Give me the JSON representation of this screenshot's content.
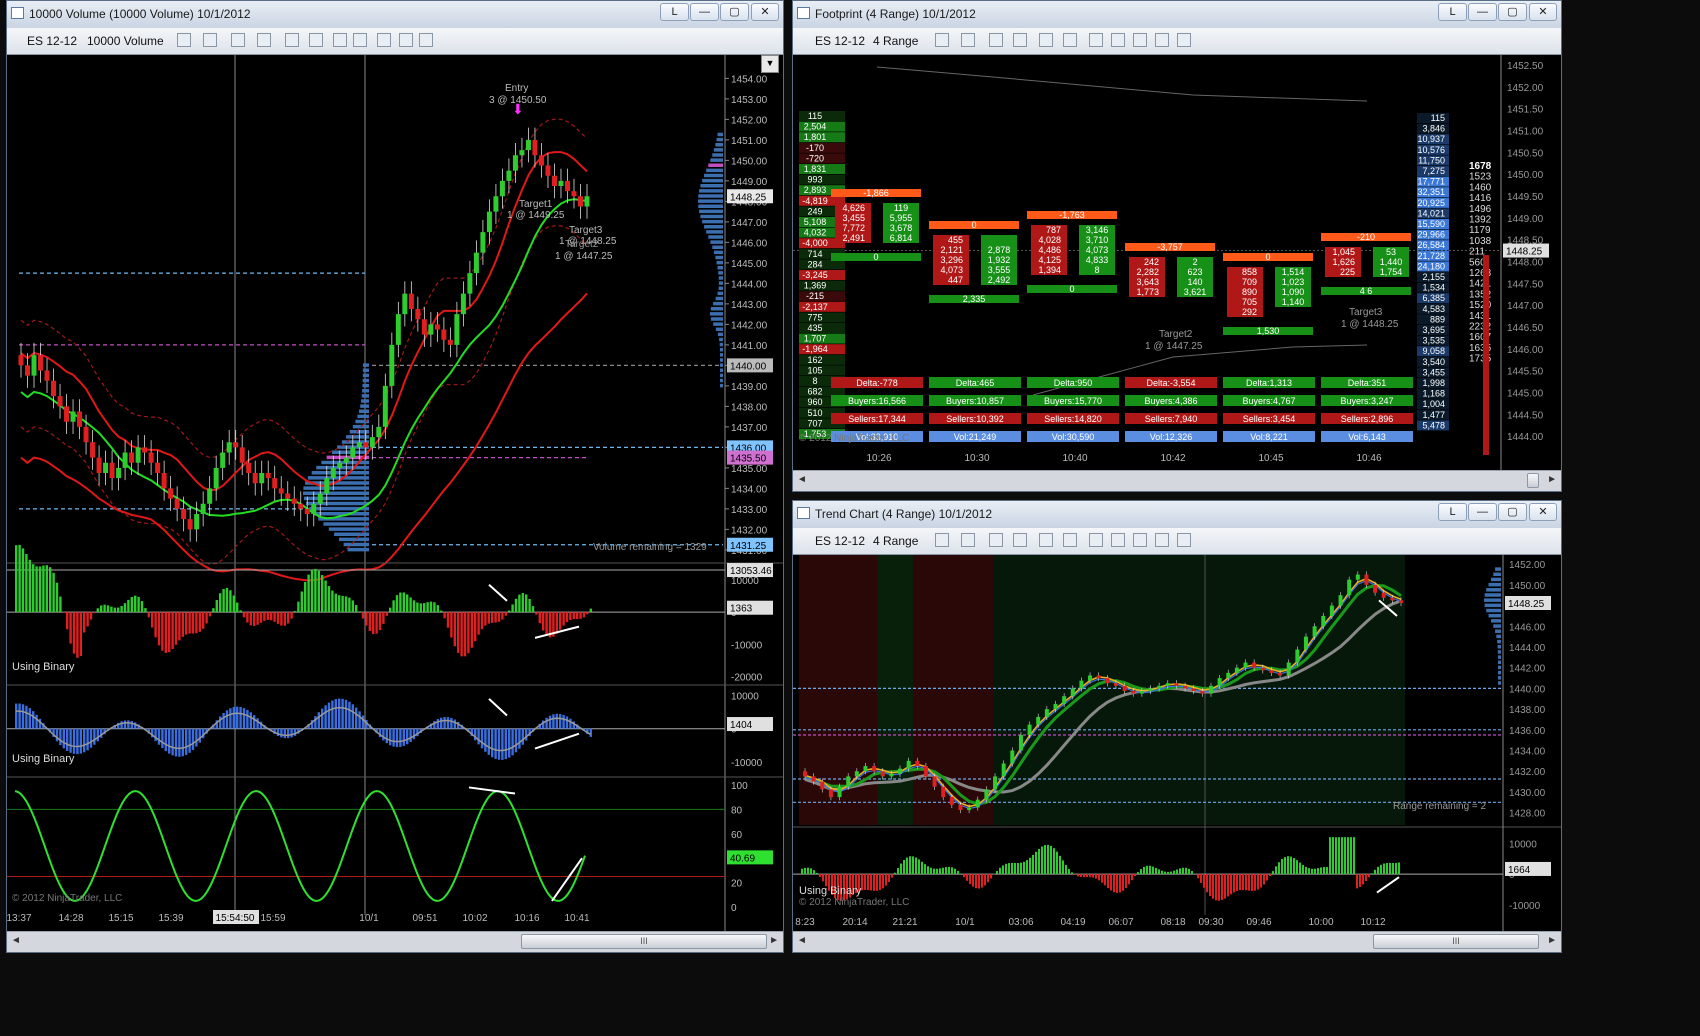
{
  "windows": {
    "left": {
      "title": "10000 Volume (10000 Volume)  10/1/2012",
      "instrument": "ES 12-12",
      "period": "10000 Volume"
    },
    "footprint": {
      "title": "Footprint (4 Range)  10/1/2012",
      "instrument": "ES 12-12",
      "period": "4 Range"
    },
    "trend": {
      "title": "Trend Chart (4 Range)  10/1/2012",
      "instrument": "ES 12-12",
      "period": "4 Range"
    },
    "controls": {
      "link": "L",
      "minimize": "—",
      "maximize": "▢",
      "close": "✕",
      "grip": "III"
    }
  },
  "colors": {
    "bull": "#2ecc2e",
    "bear": "#e02020",
    "blue": "#3a78d8",
    "orange": "#ff5a1a",
    "cyan": "#6fb8f0",
    "magenta": "#c050c0"
  },
  "chart_data": [
    {
      "id": "left-price",
      "type": "candlestick",
      "ylim": [
        1430.75,
        1454.75
      ],
      "y_ticks": [
        "1454.00",
        "1453.00",
        "1452.00",
        "1451.00",
        "1450.00",
        "1449.00",
        "1448.00",
        "1447.00",
        "1446.00",
        "1445.00",
        "1444.00",
        "1443.00",
        "1442.00",
        "1441.00",
        "1440.00",
        "1439.00",
        "1438.00",
        "1437.00",
        "1436.00",
        "1435.00",
        "1434.00",
        "1433.00",
        "1432.00",
        "1431.00"
      ],
      "price_tags": [
        {
          "text": "1448.25",
          "value": 1448.25,
          "color": "#e8e8e8"
        },
        {
          "text": "1440.00",
          "value": 1440.0,
          "color": "#bbbbbb"
        },
        {
          "text": "1436.00",
          "value": 1436.0,
          "color": "#7fc4ff"
        },
        {
          "text": "1435.50",
          "value": 1435.5,
          "color": "#d070d0"
        },
        {
          "text": "1431.25",
          "value": 1431.25,
          "color": "#7fc4ff"
        }
      ],
      "x_ticks": [
        "13:37",
        "14:28",
        "15:15",
        "15:39",
        "15:54:50",
        "15:59",
        "10/1",
        "09:51",
        "10:02",
        "10:16",
        "10:41"
      ],
      "annotations": [
        {
          "text": "Entry",
          "sub": "3 @ 1450.50"
        },
        {
          "text": "Target1",
          "sub": "1 @ 1449.25"
        },
        {
          "text": "Target3",
          "sub": "1 @ 1448.25"
        },
        {
          "text": "Target2",
          "sub": "1 @ 1447.25"
        }
      ],
      "volume_remaining": "Volume remaining = 1329",
      "close_series": [
        1440.0,
        1439.5,
        1440.5,
        1439.75,
        1439.25,
        1438.5,
        1438.0,
        1437.25,
        1437.75,
        1437.0,
        1436.25,
        1435.5,
        1434.75,
        1435.25,
        1434.5,
        1435.0,
        1435.75,
        1435.25,
        1436.0,
        1435.75,
        1435.25,
        1434.75,
        1434.0,
        1433.5,
        1433.0,
        1432.5,
        1432.0,
        1432.75,
        1433.25,
        1434.0,
        1435.0,
        1435.75,
        1436.25,
        1436.0,
        1435.25,
        1434.75,
        1434.25,
        1434.75,
        1434.5,
        1434.0,
        1433.75,
        1433.5,
        1433.25,
        1433.0,
        1432.75,
        1433.25,
        1433.75,
        1434.5,
        1435.0,
        1435.25,
        1435.5,
        1436.0,
        1436.25,
        1436.0,
        1436.5,
        1437.0,
        1439.0,
        1441.0,
        1442.5,
        1443.5,
        1442.75,
        1442.25,
        1441.5,
        1442.0,
        1441.75,
        1441.25,
        1441.0,
        1442.5,
        1443.5,
        1444.5,
        1445.5,
        1446.5,
        1447.5,
        1448.25,
        1449.0,
        1449.5,
        1450.25,
        1450.5,
        1451.0,
        1450.25,
        1449.75,
        1449.25,
        1448.75,
        1449.0,
        1448.5,
        1448.25,
        1447.75,
        1448.25
      ]
    },
    {
      "id": "left-osc1",
      "type": "bar",
      "label": "Using Binary",
      "ylim": [
        -22000,
        14000
      ],
      "y_ticks": [
        "10000",
        "0",
        "-10000",
        "-20000"
      ],
      "tags": [
        {
          "text": "13053.46",
          "value": 13053.46
        },
        {
          "text": "1363",
          "value": 1363
        }
      ]
    },
    {
      "id": "left-osc2",
      "type": "bar",
      "label": "Using Binary",
      "ylim": [
        -14000,
        12000
      ],
      "y_ticks": [
        "10000",
        "0",
        "-10000"
      ],
      "tags": [
        {
          "text": "1404",
          "value": 1404
        }
      ]
    },
    {
      "id": "left-osc3",
      "type": "line",
      "ylim": [
        0,
        100
      ],
      "y_ticks": [
        "100",
        "80",
        "60",
        "40",
        "20",
        "0"
      ],
      "tags": [
        {
          "text": "40.69",
          "value": 40.69
        }
      ],
      "watermark": "© 2012 NinjaTrader, LLC"
    },
    {
      "id": "footprint",
      "type": "footprint",
      "ylim": [
        1443.75,
        1452.5
      ],
      "y_ticks": [
        "1452.50",
        "1452.00",
        "1451.50",
        "1451.00",
        "1450.50",
        "1450.00",
        "1449.50",
        "1449.00",
        "1448.50",
        "1448.00",
        "1447.50",
        "1447.00",
        "1446.50",
        "1446.00",
        "1445.50",
        "1445.00",
        "1444.50",
        "1444.00"
      ],
      "last_price": "1448.25",
      "x_ticks": [
        "10:26",
        "10:30",
        "10:40",
        "10:42",
        "10:45",
        "10:46"
      ],
      "left_ladder": [
        "115",
        "2,504",
        "1,801",
        "-170",
        "-720",
        "1,831",
        "993",
        "2,893",
        "-4,819",
        "249",
        "5,108",
        "4,032",
        "-4,000",
        "714",
        "284",
        "-3,245",
        "1,369",
        "-215",
        "-2,137",
        "775",
        "435",
        "1,707",
        "-1,964",
        "162",
        "105",
        "8",
        "682",
        "960",
        "510",
        "707",
        "1,753"
      ],
      "right_ladder": [
        "115",
        "3,846",
        "10,937",
        "10,576",
        "11,750",
        "7,275",
        "17,771",
        "32,351",
        "20,925",
        "14,021",
        "15,590",
        "29,966",
        "26,584",
        "21,728",
        "24,180",
        "2,155",
        "1,534",
        "6,385",
        "4,583",
        "889",
        "3,695",
        "3,535",
        "9,058",
        "3,540",
        "3,455",
        "1,998",
        "1,168",
        "1,004",
        "1,477",
        "5,478"
      ],
      "profile": [
        "1678",
        "1523",
        "1460",
        "1416",
        "1496",
        "1392",
        "1179",
        "1038",
        "211",
        "560",
        "1263",
        "1421",
        "1352",
        "1520",
        "1431",
        "2232",
        "1607",
        "1635",
        "1735"
      ],
      "bars": [
        {
          "delta": "Delta:-778",
          "buyers": "Buyers:16,566",
          "sellers": "Sellers:17,344",
          "vol": "Vol:33,910",
          "top": "-1,866",
          "bottom": "0",
          "sell": [
            "4,626",
            "3,455",
            "7,772",
            "2,491"
          ],
          "buy": [
            "119",
            "5,955",
            "3,678",
            "6,814"
          ]
        },
        {
          "delta": "Delta:465",
          "buyers": "Buyers:10,857",
          "sellers": "Sellers:10,392",
          "vol": "Vol:21,249",
          "top": "0",
          "bottom": "2,335",
          "sell": [
            "455",
            "2,121",
            "3,296",
            "4,073",
            "447"
          ],
          "buy": [
            "",
            "2,878",
            "1,932",
            "3,555",
            "2,492"
          ]
        },
        {
          "delta": "Delta:950",
          "buyers": "Buyers:15,770",
          "sellers": "Sellers:14,820",
          "vol": "Vol:30,590",
          "top": "-1,763",
          "bottom": "0",
          "sell": [
            "787",
            "4,028",
            "4,486",
            "4,125",
            "1,394"
          ],
          "buy": [
            "3,146",
            "3,710",
            "4,073",
            "4,833",
            "8"
          ]
        },
        {
          "delta": "Delta:-3,554",
          "buyers": "Buyers:4,386",
          "sellers": "Sellers:7,940",
          "vol": "Vol:12,326",
          "top": "-3,757",
          "bottom": "",
          "sell": [
            "242",
            "2,282",
            "3,643",
            "1,773"
          ],
          "buy": [
            "2",
            "623",
            "140",
            "3,621"
          ]
        },
        {
          "delta": "Delta:1,313",
          "buyers": "Buyers:4,767",
          "sellers": "Sellers:3,454",
          "vol": "Vol:8,221",
          "top": "0",
          "bottom": "1,530",
          "sell": [
            "858",
            "709",
            "890",
            "705",
            "292"
          ],
          "buy": [
            "1,514",
            "1,023",
            "1,090",
            "1,140"
          ]
        },
        {
          "delta": "Delta:351",
          "buyers": "Buyers:3,247",
          "sellers": "Sellers:2,896",
          "vol": "Vol:6,143",
          "top": "-210",
          "bottom": "4 6",
          "sell": [
            "1,045",
            "1,626",
            "225"
          ],
          "buy": [
            "53",
            "1,440",
            "1,754"
          ]
        }
      ],
      "annotations": [
        {
          "text": "Target2",
          "sub": "1 @ 1447.25"
        },
        {
          "text": "Target3",
          "sub": "1 @ 1448.25"
        }
      ],
      "watermark": "© 2012 NinjaTrader, LLC"
    },
    {
      "id": "trend-price",
      "type": "candlestick",
      "ylim": [
        1427.0,
        1452.5
      ],
      "y_ticks": [
        "1452.00",
        "1450.00",
        "1448.00",
        "1446.00",
        "1444.00",
        "1442.00",
        "1440.00",
        "1438.00",
        "1436.00",
        "1434.00",
        "1432.00",
        "1430.00",
        "1428.00"
      ],
      "last_price": "1448.25",
      "x_ticks": [
        "8:23",
        "20:14",
        "21:21",
        "10/1",
        "03:06",
        "04:19",
        "06:07",
        "08:18",
        "09:30",
        "09:46",
        "10:00",
        "10:12"
      ],
      "range_remaining": "Range remaining = 2",
      "close_series": [
        1431.5,
        1431.0,
        1430.25,
        1429.5,
        1430.5,
        1431.5,
        1432.0,
        1432.5,
        1432.0,
        1431.5,
        1431.75,
        1432.25,
        1433.0,
        1432.5,
        1431.5,
        1430.5,
        1429.5,
        1428.75,
        1428.25,
        1428.5,
        1429.25,
        1430.25,
        1431.5,
        1432.75,
        1434.0,
        1435.5,
        1436.5,
        1437.25,
        1438.0,
        1438.5,
        1439.25,
        1440.0,
        1440.75,
        1441.25,
        1441.0,
        1440.5,
        1440.25,
        1439.75,
        1439.5,
        1439.75,
        1440.0,
        1440.25,
        1440.5,
        1440.25,
        1440.0,
        1439.75,
        1439.5,
        1440.25,
        1441.0,
        1441.5,
        1442.0,
        1442.5,
        1442.0,
        1441.75,
        1441.5,
        1441.25,
        1442.5,
        1443.75,
        1445.0,
        1446.0,
        1447.0,
        1448.0,
        1449.0,
        1450.5,
        1451.0,
        1450.0,
        1449.25,
        1448.75,
        1448.5,
        1448.25
      ],
      "levels": [
        1440.0,
        1436.0,
        1435.5,
        1431.25,
        1429.0
      ]
    },
    {
      "id": "trend-osc",
      "type": "bar",
      "label": "Using Binary",
      "ylim": [
        -12000,
        14000
      ],
      "y_ticks": [
        "10000",
        "0",
        "-10000"
      ],
      "tags": [
        {
          "text": "1664",
          "value": 1664
        }
      ],
      "watermark": "© 2012 NinjaTrader, LLC"
    }
  ]
}
